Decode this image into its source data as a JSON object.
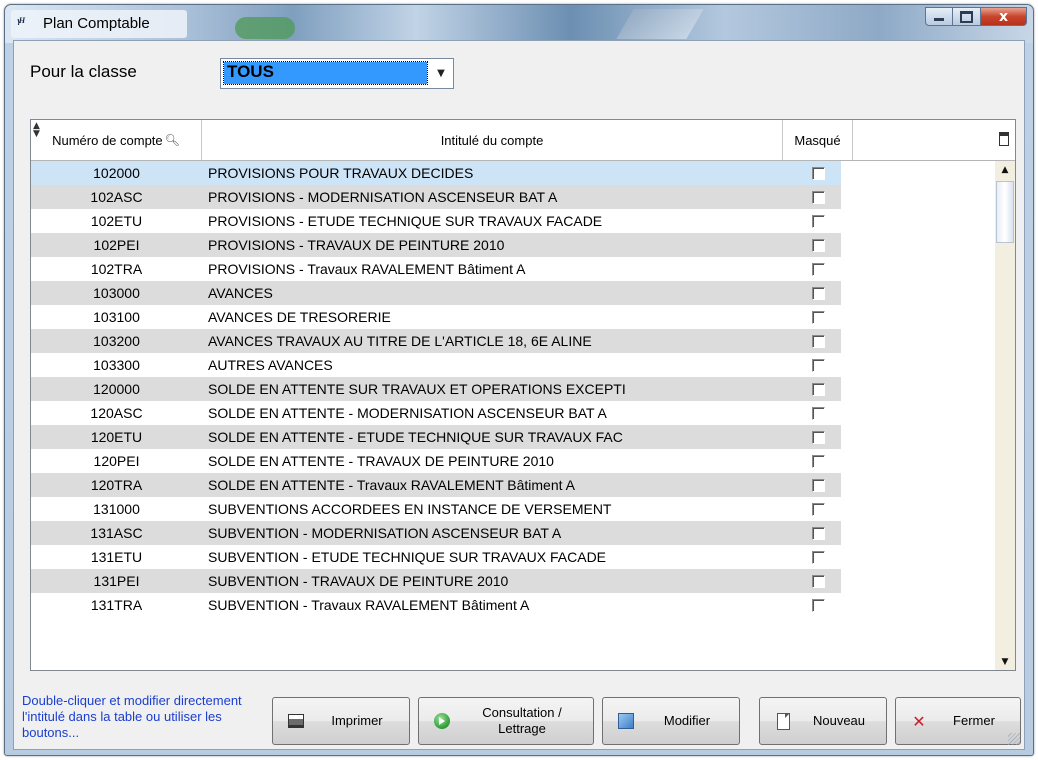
{
  "window": {
    "title": "Plan Comptable",
    "app_icon_text": "ᵞᴴ",
    "close_symbol": "x"
  },
  "filter": {
    "label": "Pour la classe",
    "selected": "TOUS"
  },
  "grid": {
    "columns": {
      "number": "Numéro de compte",
      "label": "Intitulé du compte",
      "hidden": "Masqué"
    },
    "rows": [
      {
        "number": "102000",
        "label": "PROVISIONS POUR TRAVAUX DECIDES",
        "hidden": false
      },
      {
        "number": "102ASC",
        "label": "PROVISIONS - MODERNISATION ASCENSEUR BAT A",
        "hidden": false
      },
      {
        "number": "102ETU",
        "label": "PROVISIONS - ETUDE TECHNIQUE SUR TRAVAUX FACADE",
        "hidden": false
      },
      {
        "number": "102PEI",
        "label": "PROVISIONS - TRAVAUX DE PEINTURE 2010",
        "hidden": false
      },
      {
        "number": "102TRA",
        "label": "PROVISIONS - Travaux RAVALEMENT Bâtiment A",
        "hidden": false
      },
      {
        "number": "103000",
        "label": "AVANCES",
        "hidden": false
      },
      {
        "number": "103100",
        "label": "AVANCES DE TRESORERIE",
        "hidden": false
      },
      {
        "number": "103200",
        "label": "AVANCES TRAVAUX AU TITRE DE L'ARTICLE 18, 6E ALINE",
        "hidden": false
      },
      {
        "number": "103300",
        "label": "AUTRES AVANCES",
        "hidden": false
      },
      {
        "number": "120000",
        "label": "SOLDE EN ATTENTE SUR TRAVAUX ET OPERATIONS EXCEPTI",
        "hidden": false
      },
      {
        "number": "120ASC",
        "label": "SOLDE EN ATTENTE - MODERNISATION ASCENSEUR BAT A",
        "hidden": false
      },
      {
        "number": "120ETU",
        "label": "SOLDE EN ATTENTE - ETUDE TECHNIQUE SUR TRAVAUX FAC",
        "hidden": false
      },
      {
        "number": "120PEI",
        "label": "SOLDE EN ATTENTE - TRAVAUX DE PEINTURE 2010",
        "hidden": false
      },
      {
        "number": "120TRA",
        "label": "SOLDE EN ATTENTE - Travaux RAVALEMENT Bâtiment A",
        "hidden": false
      },
      {
        "number": "131000",
        "label": "SUBVENTIONS ACCORDEES EN INSTANCE DE VERSEMENT",
        "hidden": false
      },
      {
        "number": "131ASC",
        "label": "SUBVENTION - MODERNISATION ASCENSEUR BAT A",
        "hidden": false
      },
      {
        "number": "131ETU",
        "label": "SUBVENTION - ETUDE TECHNIQUE SUR TRAVAUX FACADE",
        "hidden": false
      },
      {
        "number": "131PEI",
        "label": "SUBVENTION - TRAVAUX DE PEINTURE 2010",
        "hidden": false
      },
      {
        "number": "131TRA",
        "label": "SUBVENTION - Travaux RAVALEMENT Bâtiment A",
        "hidden": false
      }
    ]
  },
  "footer": {
    "hint": "Double-cliquer et modifier directement l'intitulé dans la table ou utiliser les boutons...",
    "buttons": {
      "print": "Imprimer",
      "consult": "Consultation / Lettrage",
      "edit": "Modifier",
      "new": "Nouveau",
      "close": "Fermer"
    }
  },
  "colors": {
    "selection": "#3399ff",
    "selected_row": "#cde3f6",
    "alt_row": "#dcdcdc",
    "hint_text": "#1a3ecf",
    "close_button": "#c8452c"
  },
  "icons": {
    "print": "printer-icon",
    "consult": "green-arrow-icon",
    "edit": "edit-image-icon",
    "new": "new-document-icon",
    "close": "red-close-icon",
    "search": "magnifier-icon",
    "columns": "column-chooser-icon"
  }
}
